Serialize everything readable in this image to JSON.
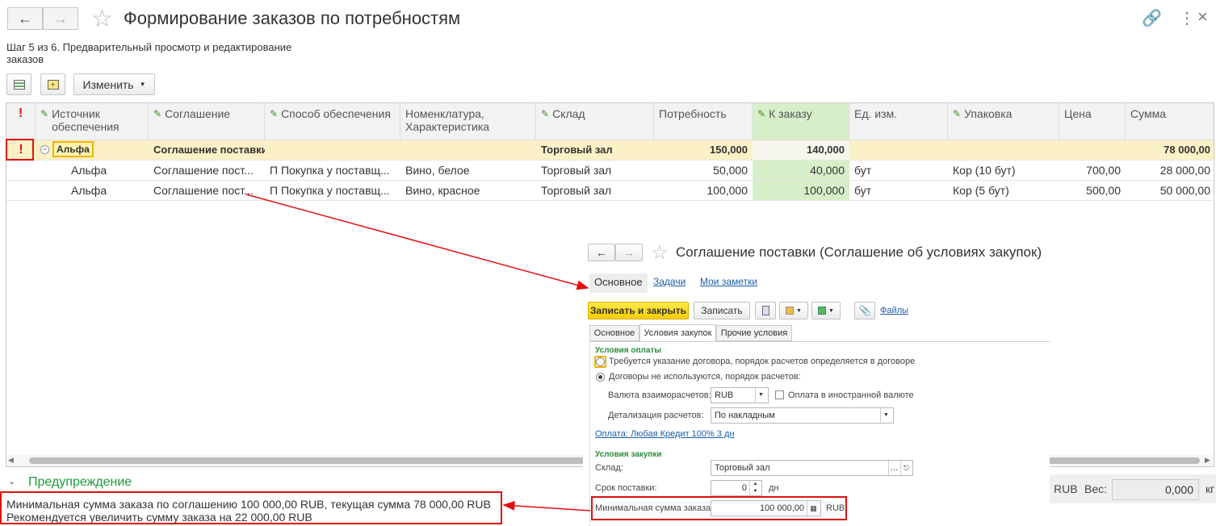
{
  "window": {
    "title": "Формирование заказов по потребностям",
    "step_text": "Шаг 5 из 6. Предварительный просмотр и редактирование заказов"
  },
  "toolbar": {
    "change_label": "Изменить"
  },
  "table": {
    "headers": {
      "warn": "!",
      "source": "Источник обеспечения",
      "agreement": "Соглашение",
      "method": "Способ обеспечения",
      "nomenclature": "Номенклатура, Характеристика",
      "warehouse": "Склад",
      "need": "Потребность",
      "to_order": "К заказу",
      "unit": "Ед. изм.",
      "package": "Упаковка",
      "price": "Цена",
      "sum": "Сумма"
    },
    "group": {
      "warn": "!",
      "source": "Альфа",
      "agreement": "Соглашение поставки",
      "warehouse": "Торговый зал",
      "need": "150,000",
      "to_order": "140,000",
      "sum": "78 000,00"
    },
    "rows": [
      {
        "source": "Альфа",
        "agreement": "Соглашение пост...",
        "method": "П Покупка у поставщ...",
        "nomenclature": "Вино, белое",
        "warehouse": "Торговый зал",
        "need": "50,000",
        "to_order": "40,000",
        "unit": "бут",
        "package": "Кор (10 бут)",
        "price": "700,00",
        "sum": "28 000,00"
      },
      {
        "source": "Альфа",
        "agreement": "Соглашение пост...",
        "method": "П Покупка у поставщ...",
        "nomenclature": "Вино, красное",
        "warehouse": "Торговый зал",
        "need": "100,000",
        "to_order": "100,000",
        "unit": "бут",
        "package": "Кор (5 бут)",
        "price": "500,00",
        "sum": "50 000,00"
      }
    ]
  },
  "warning": {
    "title": "Предупреждение",
    "line1": "Минимальная сумма заказа по соглашению 100 000,00 RUB, текущая сумма 78 000,00 RUB",
    "line2": "Рекомендуется увеличить сумму заказа на 22 000,00 RUB"
  },
  "footer": {
    "currency": "RUB",
    "weight_label": "Вес:",
    "weight_value": "0,000",
    "weight_unit": "кг"
  },
  "popup": {
    "title": "Соглашение поставки (Соглашение об условиях закупок)",
    "nav_tabs": [
      "Основное",
      "Задачи",
      "Мои заметки"
    ],
    "save_close": "Записать и закрыть",
    "save": "Записать",
    "files": "Файлы",
    "inner_tabs": [
      "Основное",
      "Условия закупок",
      "Прочие условия"
    ],
    "payment_section": "Условия оплаты",
    "radio1": "Требуется указание договора, порядок расчетов определяется в договоре",
    "radio2": "Договоры не используются, порядок расчетов:",
    "currency_label": "Валюта взаиморасчетов:",
    "currency_value": "RUB",
    "foreign_currency": "Оплата в иностранной валюте",
    "detail_label": "Детализация расчетов:",
    "detail_value": "По накладным",
    "payment_link": "Оплата: Любая Кредит 100% 3 дн",
    "purchase_section": "Условия закупки",
    "warehouse_label": "Склад:",
    "warehouse_value": "Торговый зал",
    "lead_label": "Срок поставки:",
    "lead_value": "0",
    "lead_unit": "дн",
    "min_label": "Минимальная сумма заказа:",
    "min_value": "100 000,00",
    "min_currency": "RUB"
  }
}
